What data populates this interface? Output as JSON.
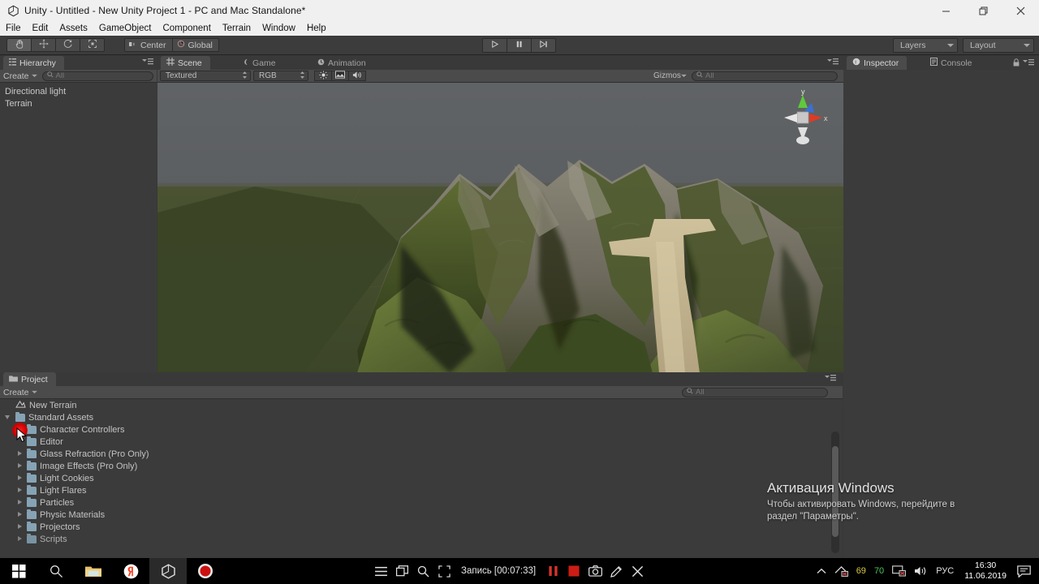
{
  "window": {
    "title": "Unity - Untitled - New Unity Project 1 - PC and Mac Standalone*",
    "logo_icon": "unity-logo-icon",
    "minimize_label": "–",
    "restore_label": "❐",
    "close_label": "✕"
  },
  "menubar": {
    "items": [
      {
        "label": "File"
      },
      {
        "label": "Edit"
      },
      {
        "label": "Assets"
      },
      {
        "label": "GameObject"
      },
      {
        "label": "Component"
      },
      {
        "label": "Terrain"
      },
      {
        "label": "Window"
      },
      {
        "label": "Help"
      }
    ]
  },
  "toolbar": {
    "transform_tools": [
      {
        "name": "hand-tool",
        "icon": "hand-icon",
        "active": true
      },
      {
        "name": "move-tool",
        "icon": "move-icon",
        "active": false
      },
      {
        "name": "rotate-tool",
        "icon": "rotate-icon",
        "active": false
      },
      {
        "name": "scale-tool",
        "icon": "scale-icon",
        "active": false
      }
    ],
    "pivot_label": "Center",
    "rotation_label": "Global",
    "play_icon": "play-icon",
    "pause_icon": "pause-icon",
    "step_icon": "step-icon",
    "layers_label": "Layers",
    "layout_label": "Layout"
  },
  "hierarchy": {
    "tab_label": "Hierarchy",
    "tab_icon": "hierarchy-icon",
    "create_label": "Create",
    "search_placeholder": "All",
    "search_value": "",
    "items": [
      {
        "label": "Directional light"
      },
      {
        "label": "Terrain"
      }
    ]
  },
  "scene": {
    "tabs": [
      {
        "label": "Scene",
        "icon": "scene-grid-icon",
        "active": true
      },
      {
        "label": "Game",
        "icon": "game-icon",
        "active": false
      },
      {
        "label": "Animation",
        "icon": "animation-icon",
        "active": false
      }
    ],
    "draw_mode": "Textured",
    "render_mode": "RGB",
    "toggles": [
      {
        "name": "scene-lighting-toggle",
        "icon": "sun-icon"
      },
      {
        "name": "scene-fx-toggle",
        "icon": "image-icon"
      },
      {
        "name": "scene-audio-toggle",
        "icon": "speaker-icon"
      }
    ],
    "gizmos_label": "Gizmos",
    "search_placeholder": "All",
    "search_value": "",
    "axis_gizmo": {
      "y_label": "y",
      "x_label": "x"
    },
    "colors": {
      "sky": "#5b5e60",
      "ground": "#4f5833",
      "grass": "#3f4a22",
      "rock": "#7d7b6e",
      "path": "#c9bb97"
    }
  },
  "project": {
    "tab_label": "Project",
    "tab_icon": "folder-icon",
    "create_label": "Create",
    "items": [
      {
        "label": "New Terrain",
        "icon": "terrain-icon",
        "indent": 0,
        "arrow": "none"
      },
      {
        "label": "Standard Assets",
        "icon": "folder-icon",
        "indent": 0,
        "arrow": "down"
      },
      {
        "label": "Character Controllers",
        "icon": "folder-icon",
        "indent": 1,
        "arrow": "right",
        "highlighted": true
      },
      {
        "label": "Editor",
        "icon": "folder-icon",
        "indent": 1,
        "arrow": "none"
      },
      {
        "label": "Glass Refraction (Pro Only)",
        "icon": "folder-icon",
        "indent": 1,
        "arrow": "right"
      },
      {
        "label": "Image Effects (Pro Only)",
        "icon": "folder-icon",
        "indent": 1,
        "arrow": "right"
      },
      {
        "label": "Light Cookies",
        "icon": "folder-icon",
        "indent": 1,
        "arrow": "right"
      },
      {
        "label": "Light Flares",
        "icon": "folder-icon",
        "indent": 1,
        "arrow": "right"
      },
      {
        "label": "Particles",
        "icon": "folder-icon",
        "indent": 1,
        "arrow": "right"
      },
      {
        "label": "Physic Materials",
        "icon": "folder-icon",
        "indent": 1,
        "arrow": "right"
      },
      {
        "label": "Projectors",
        "icon": "folder-icon",
        "indent": 1,
        "arrow": "right"
      },
      {
        "label": "Scripts",
        "icon": "folder-icon",
        "indent": 1,
        "arrow": "right"
      }
    ]
  },
  "inspector": {
    "tabs": [
      {
        "label": "Inspector",
        "icon": "inspector-icon",
        "active": true
      },
      {
        "label": "Console",
        "icon": "console-icon",
        "active": false
      }
    ],
    "lock_icon": "lock-icon",
    "menu_icon": "hamburger-icon"
  },
  "watermark": {
    "title": "Активация Windows",
    "line1": "Чтобы активировать Windows, перейдите в",
    "line2": "раздел \"Параметры\"."
  },
  "taskbar": {
    "icons": [
      {
        "name": "start-button",
        "icon": "windows-icon"
      },
      {
        "name": "search-button",
        "icon": "search-icon"
      },
      {
        "name": "file-explorer-button",
        "icon": "folder-icon"
      },
      {
        "name": "yandex-browser-button",
        "icon": "yandex-icon"
      },
      {
        "name": "unity-taskbar-button",
        "icon": "unity-logo-icon",
        "active": true
      },
      {
        "name": "recorder-taskbar-button",
        "icon": "record-icon"
      }
    ],
    "recorder": {
      "menu_icon": "hamburger-icon",
      "window_icon": "window-icon",
      "zoom_icon": "search-icon",
      "region_icon": "region-icon",
      "status_text": "Запись [00:07:33]",
      "pause_icon": "pause-icon",
      "stop_icon": "stop-icon",
      "camera_icon": "camera-icon",
      "pen_icon": "pen-icon",
      "close_icon": "close-icon"
    },
    "tray": {
      "chevron_icon": "chevron-up-icon",
      "items": [
        {
          "name": "network-tray-icon",
          "icon": "network-icon"
        },
        {
          "name": "counter-69",
          "label": "69",
          "color": "#d8c840"
        },
        {
          "name": "counter-70",
          "label": "70",
          "color": "#49c455"
        },
        {
          "name": "display-tray-icon",
          "icon": "monitor-icon"
        },
        {
          "name": "volume-tray-icon",
          "icon": "speaker-icon"
        },
        {
          "name": "language-indicator",
          "label": "РУС"
        }
      ],
      "time": "16:30",
      "date": "11.06.2019",
      "notification_icon": "notification-icon"
    }
  }
}
